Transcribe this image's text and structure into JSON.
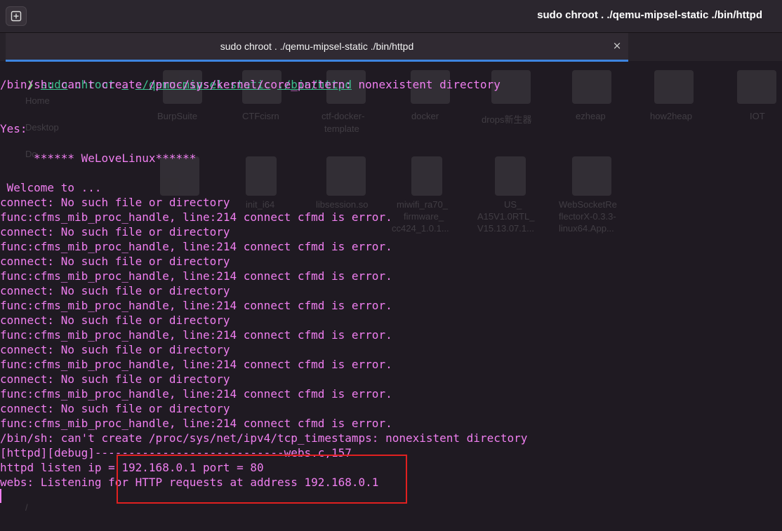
{
  "window": {
    "title": "sudo chroot . ./qemu-mipsel-static ./bin/httpd"
  },
  "tab": {
    "label": "sudo chroot . ./qemu-mipsel-static ./bin/httpd",
    "close_glyph": "×"
  },
  "background_desktop": {
    "sidebar": [
      "Home",
      "Desktop",
      "Do"
    ],
    "icons_row1": [
      "BurpSuite",
      "CTFcisrn",
      "ctf-docker-",
      "template",
      "docker",
      "drops新生器",
      "ezheap",
      "how2heap",
      "IOT"
    ],
    "icons_row2": [
      "init_i64",
      "libsession.so",
      "miwifi_ra70_",
      "firmware_",
      "cc424_1.0.1...",
      "US_",
      "A15V1.0RTL_",
      "V15.13.07.1...",
      "WebSocketRe",
      "flectorX-0.3.3-",
      "linux64.App..."
    ],
    "path": "/"
  },
  "terminal": {
    "command": {
      "prompt": "❯",
      "cmd": "sudo",
      "arg1": "chroot",
      "arg2": ".",
      "arg3": "./qemu-mipsel-static",
      "arg4": "./bin/httpd"
    },
    "lines": [
      "/bin/sh: can't create /proc/sys/kernel/core_pattern: nonexistent directory",
      "",
      "",
      "Yes:",
      "",
      "     ****** WeLoveLinux******",
      "",
      " Welcome to ...",
      "connect: No such file or directory",
      "func:cfms_mib_proc_handle, line:214 connect cfmd is error.",
      "connect: No such file or directory",
      "func:cfms_mib_proc_handle, line:214 connect cfmd is error.",
      "connect: No such file or directory",
      "func:cfms_mib_proc_handle, line:214 connect cfmd is error.",
      "connect: No such file or directory",
      "func:cfms_mib_proc_handle, line:214 connect cfmd is error.",
      "connect: No such file or directory",
      "func:cfms_mib_proc_handle, line:214 connect cfmd is error.",
      "connect: No such file or directory",
      "func:cfms_mib_proc_handle, line:214 connect cfmd is error.",
      "connect: No such file or directory",
      "func:cfms_mib_proc_handle, line:214 connect cfmd is error.",
      "connect: No such file or directory",
      "func:cfms_mib_proc_handle, line:214 connect cfmd is error.",
      "/bin/sh: can't create /proc/sys/net/ipv4/tcp_timestamps: nonexistent directory",
      "[httpd][debug]----------------------------webs.c,157",
      "httpd listen ip = 192.168.0.1 port = 80",
      "webs: Listening for HTTP requests at address 192.168.0.1"
    ]
  },
  "colors": {
    "terminal_bg": "#1f1a22",
    "output_text": "#f07ff0",
    "command_text": "#3dbf8e",
    "highlight_box": "#e02020",
    "tab_accent": "#3d85e0"
  }
}
